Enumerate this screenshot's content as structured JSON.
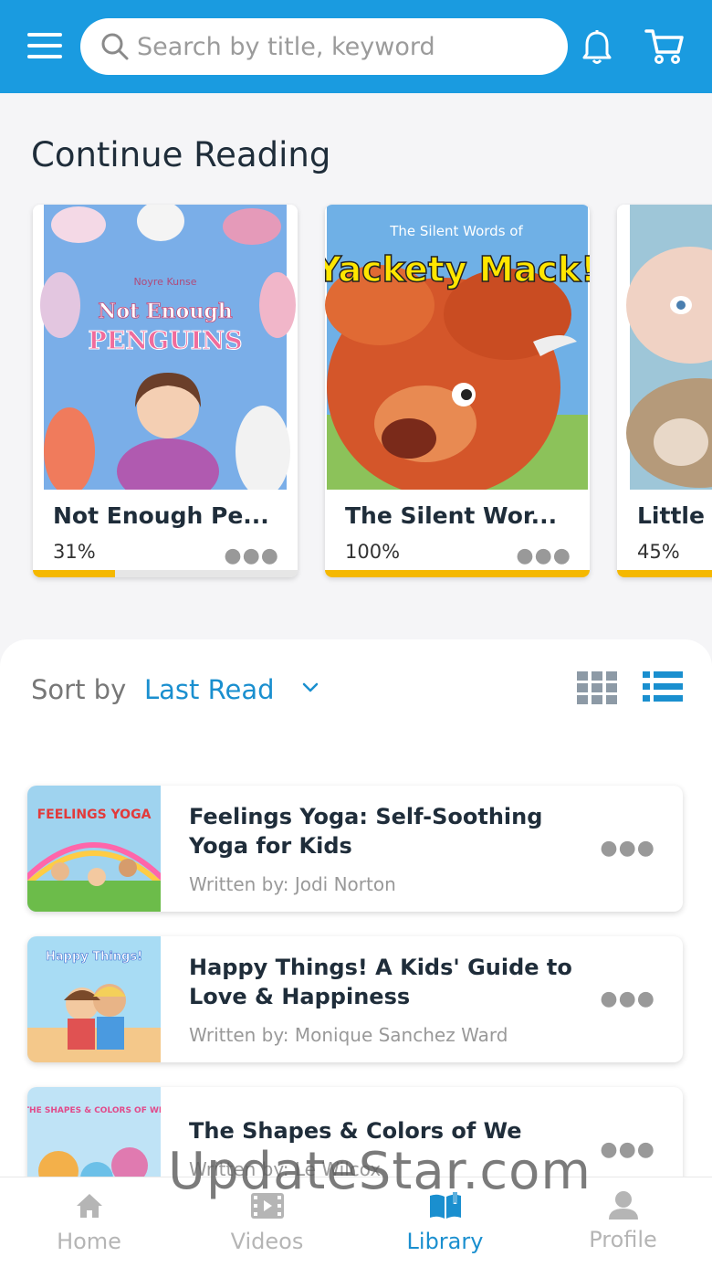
{
  "header": {
    "search_placeholder": "Search by title, keyword",
    "icons": [
      "menu-icon",
      "search-icon",
      "bell-icon",
      "cart-icon"
    ],
    "color": "#1a9be0"
  },
  "continue_reading": {
    "title": "Continue Reading",
    "books": [
      {
        "title": "Not Enough Pe...",
        "progress_label": "31%",
        "progress": 0.31,
        "cover_title_line1": "Not Enough",
        "cover_title_line2": "PENGUINS",
        "cover_author": "Noyre Kunse"
      },
      {
        "title": "The Silent Wor...",
        "progress_label": "100%",
        "progress": 1.0,
        "cover_title_top": "The Silent Words of",
        "cover_title_main": "Yackety Mack!"
      },
      {
        "title": "Little",
        "progress_label": "45%",
        "progress": 0.45
      }
    ]
  },
  "library": {
    "sort_label": "Sort by",
    "sort_value": "Last Read",
    "view_icons": [
      "grid-view-icon",
      "list-view-icon"
    ],
    "items": [
      {
        "title": "Feelings Yoga: Self-Soothing Yoga for Kids",
        "author": "Written by: Jodi Norton",
        "cover_text": "FEELINGS YOGA"
      },
      {
        "title": "Happy Things! A Kids' Guide to Love & Happiness",
        "author": "Written by: Monique Sanchez Ward",
        "cover_text": "Happy Things!"
      },
      {
        "title": "The Shapes & Colors of We",
        "author": "Written by: Le Wilcox",
        "cover_text": "THE SHAPES & COLORS OF WE"
      }
    ]
  },
  "bottom_nav": [
    {
      "label": "Home",
      "icon": "home-icon"
    },
    {
      "label": "Videos",
      "icon": "video-icon"
    },
    {
      "label": "Library",
      "icon": "book-icon",
      "active": true
    },
    {
      "label": "Profile",
      "icon": "profile-icon"
    }
  ],
  "watermark": "UpdateStar.com",
  "colors": {
    "accent": "#1a8fcf",
    "progress": "#f5b800"
  }
}
